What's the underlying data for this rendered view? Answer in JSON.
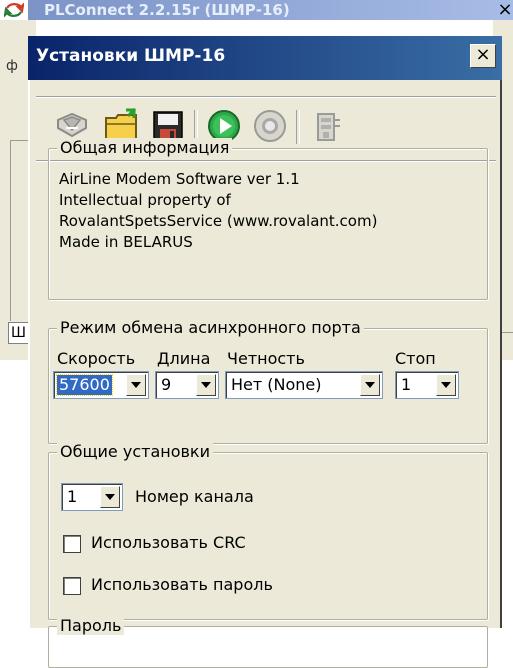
{
  "main_window": {
    "title": "PLConnect 2.2.15r (ШМР-16)",
    "close_label": "×",
    "left_letter": "ф",
    "left_box_label": "Ш"
  },
  "dialog": {
    "title": "Установки ШМР-16",
    "close_label": "×",
    "toolbar": {
      "buttons": [
        {
          "name": "connect",
          "icon": "cable-icon",
          "disabled": true
        },
        {
          "name": "open",
          "icon": "folder-open-icon"
        },
        {
          "name": "save",
          "icon": "floppy-save-icon"
        },
        {
          "name": "play",
          "icon": "green-play-icon"
        },
        {
          "name": "stop",
          "icon": "stop-icon",
          "disabled": true
        },
        {
          "name": "device",
          "icon": "device-icon",
          "disabled": true
        }
      ]
    },
    "general_info": {
      "legend": "Общая информация",
      "lines": [
        "AirLine Modem Software ver 1.1",
        "Intellectual property of",
        "RovalantSpetsService (www.rovalant.com)",
        "Made in BELARUS"
      ]
    },
    "port_mode": {
      "legend": "Режим обмена асинхронного порта",
      "speed_label": "Скорость",
      "speed_value": "57600",
      "length_label": "Длина",
      "length_value": "9",
      "parity_label": "Четность",
      "parity_value": "Нет (None)",
      "stop_label": "Стоп",
      "stop_value": "1"
    },
    "general_settings": {
      "legend": "Общие установки",
      "channel_value": "1",
      "channel_label": "Номер канала",
      "use_crc_label": "Использовать CRC",
      "use_crc_checked": false,
      "use_password_label": "Использовать пароль",
      "use_password_checked": false
    },
    "password_group": {
      "legend": "Пароль"
    }
  },
  "colors": {
    "dialog_bg": "#ece9d8",
    "title_active": "#0a246a",
    "title_inactive": "#7b93c6",
    "selection": "#316ac5"
  }
}
